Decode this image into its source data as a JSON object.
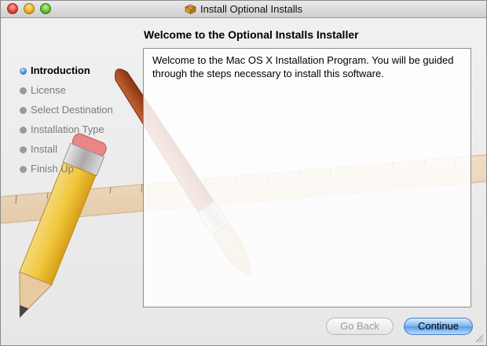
{
  "window": {
    "title": "Install Optional Installs",
    "title_icon": "package-icon"
  },
  "heading": "Welcome to the Optional Installs Installer",
  "steps": [
    {
      "label": "Introduction",
      "state": "active"
    },
    {
      "label": "License",
      "state": "inactive"
    },
    {
      "label": "Select Destination",
      "state": "inactive"
    },
    {
      "label": "Installation Type",
      "state": "inactive"
    },
    {
      "label": "Install",
      "state": "inactive"
    },
    {
      "label": "Finish Up",
      "state": "inactive"
    }
  ],
  "content": {
    "body": "Welcome to the Mac OS X Installation Program. You will be guided through the steps necessary to install this software."
  },
  "buttons": {
    "back": "Go Back",
    "continue": "Continue"
  },
  "colors": {
    "accent": "#3a7fd6",
    "inactive_text": "#7b7b7b"
  }
}
